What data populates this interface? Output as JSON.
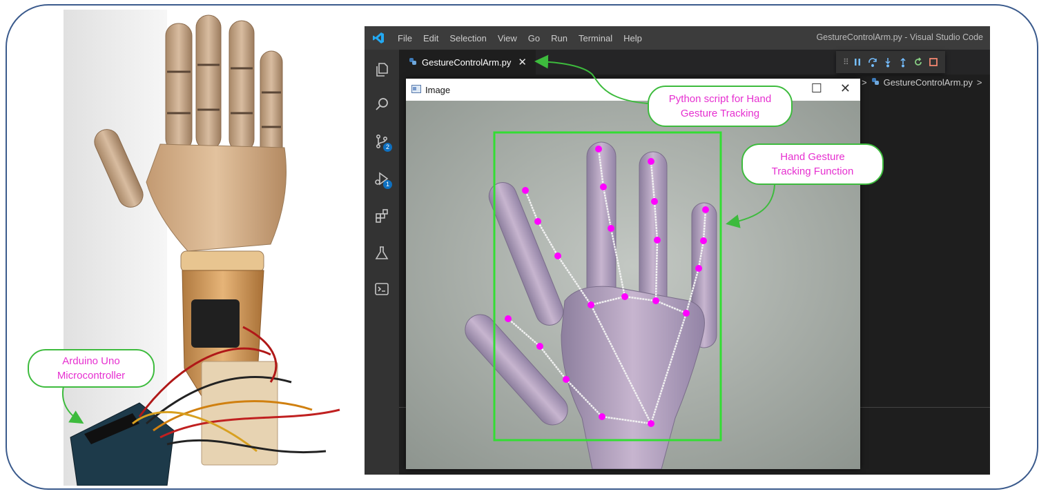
{
  "vscode": {
    "menu": [
      "File",
      "Edit",
      "Selection",
      "View",
      "Go",
      "Run",
      "Terminal",
      "Help"
    ],
    "window_title": "GestureControlArm.py - Visual Studio Code",
    "tab_label": "GestureControlArm.py",
    "tab_close": "✕",
    "breadcrumb": "GestureControlArm.py",
    "breadcrumb_sep": ">",
    "badges": {
      "source_control": "2",
      "run_debug": "1"
    },
    "icons": [
      "vscode-logo-icon",
      "explorer-icon",
      "search-icon",
      "source-control-icon",
      "run-debug-icon",
      "extensions-icon",
      "testing-icon",
      "terminal-icon"
    ],
    "debug_toolbar_icons": [
      "drag-handle-icon",
      "pause-icon",
      "step-over-icon",
      "step-into-icon",
      "step-out-icon",
      "restart-icon",
      "stop-icon"
    ]
  },
  "image_window": {
    "title": "Image",
    "minimize": "—",
    "maximize": "☐",
    "close": "✕",
    "bbox_color": "#33dd33",
    "landmark_color": "#ff00ff"
  },
  "callouts": {
    "script": [
      "Python script for Hand",
      "Gesture Tracking"
    ],
    "function": [
      "Hand Gesture",
      "Tracking Function"
    ],
    "arduino": [
      "Arduino Uno",
      "Microcontroller"
    ]
  },
  "colors": {
    "callout_text": "#e62fd0",
    "callout_border": "#3dbb3d",
    "frame_border": "#3a5a8c"
  }
}
